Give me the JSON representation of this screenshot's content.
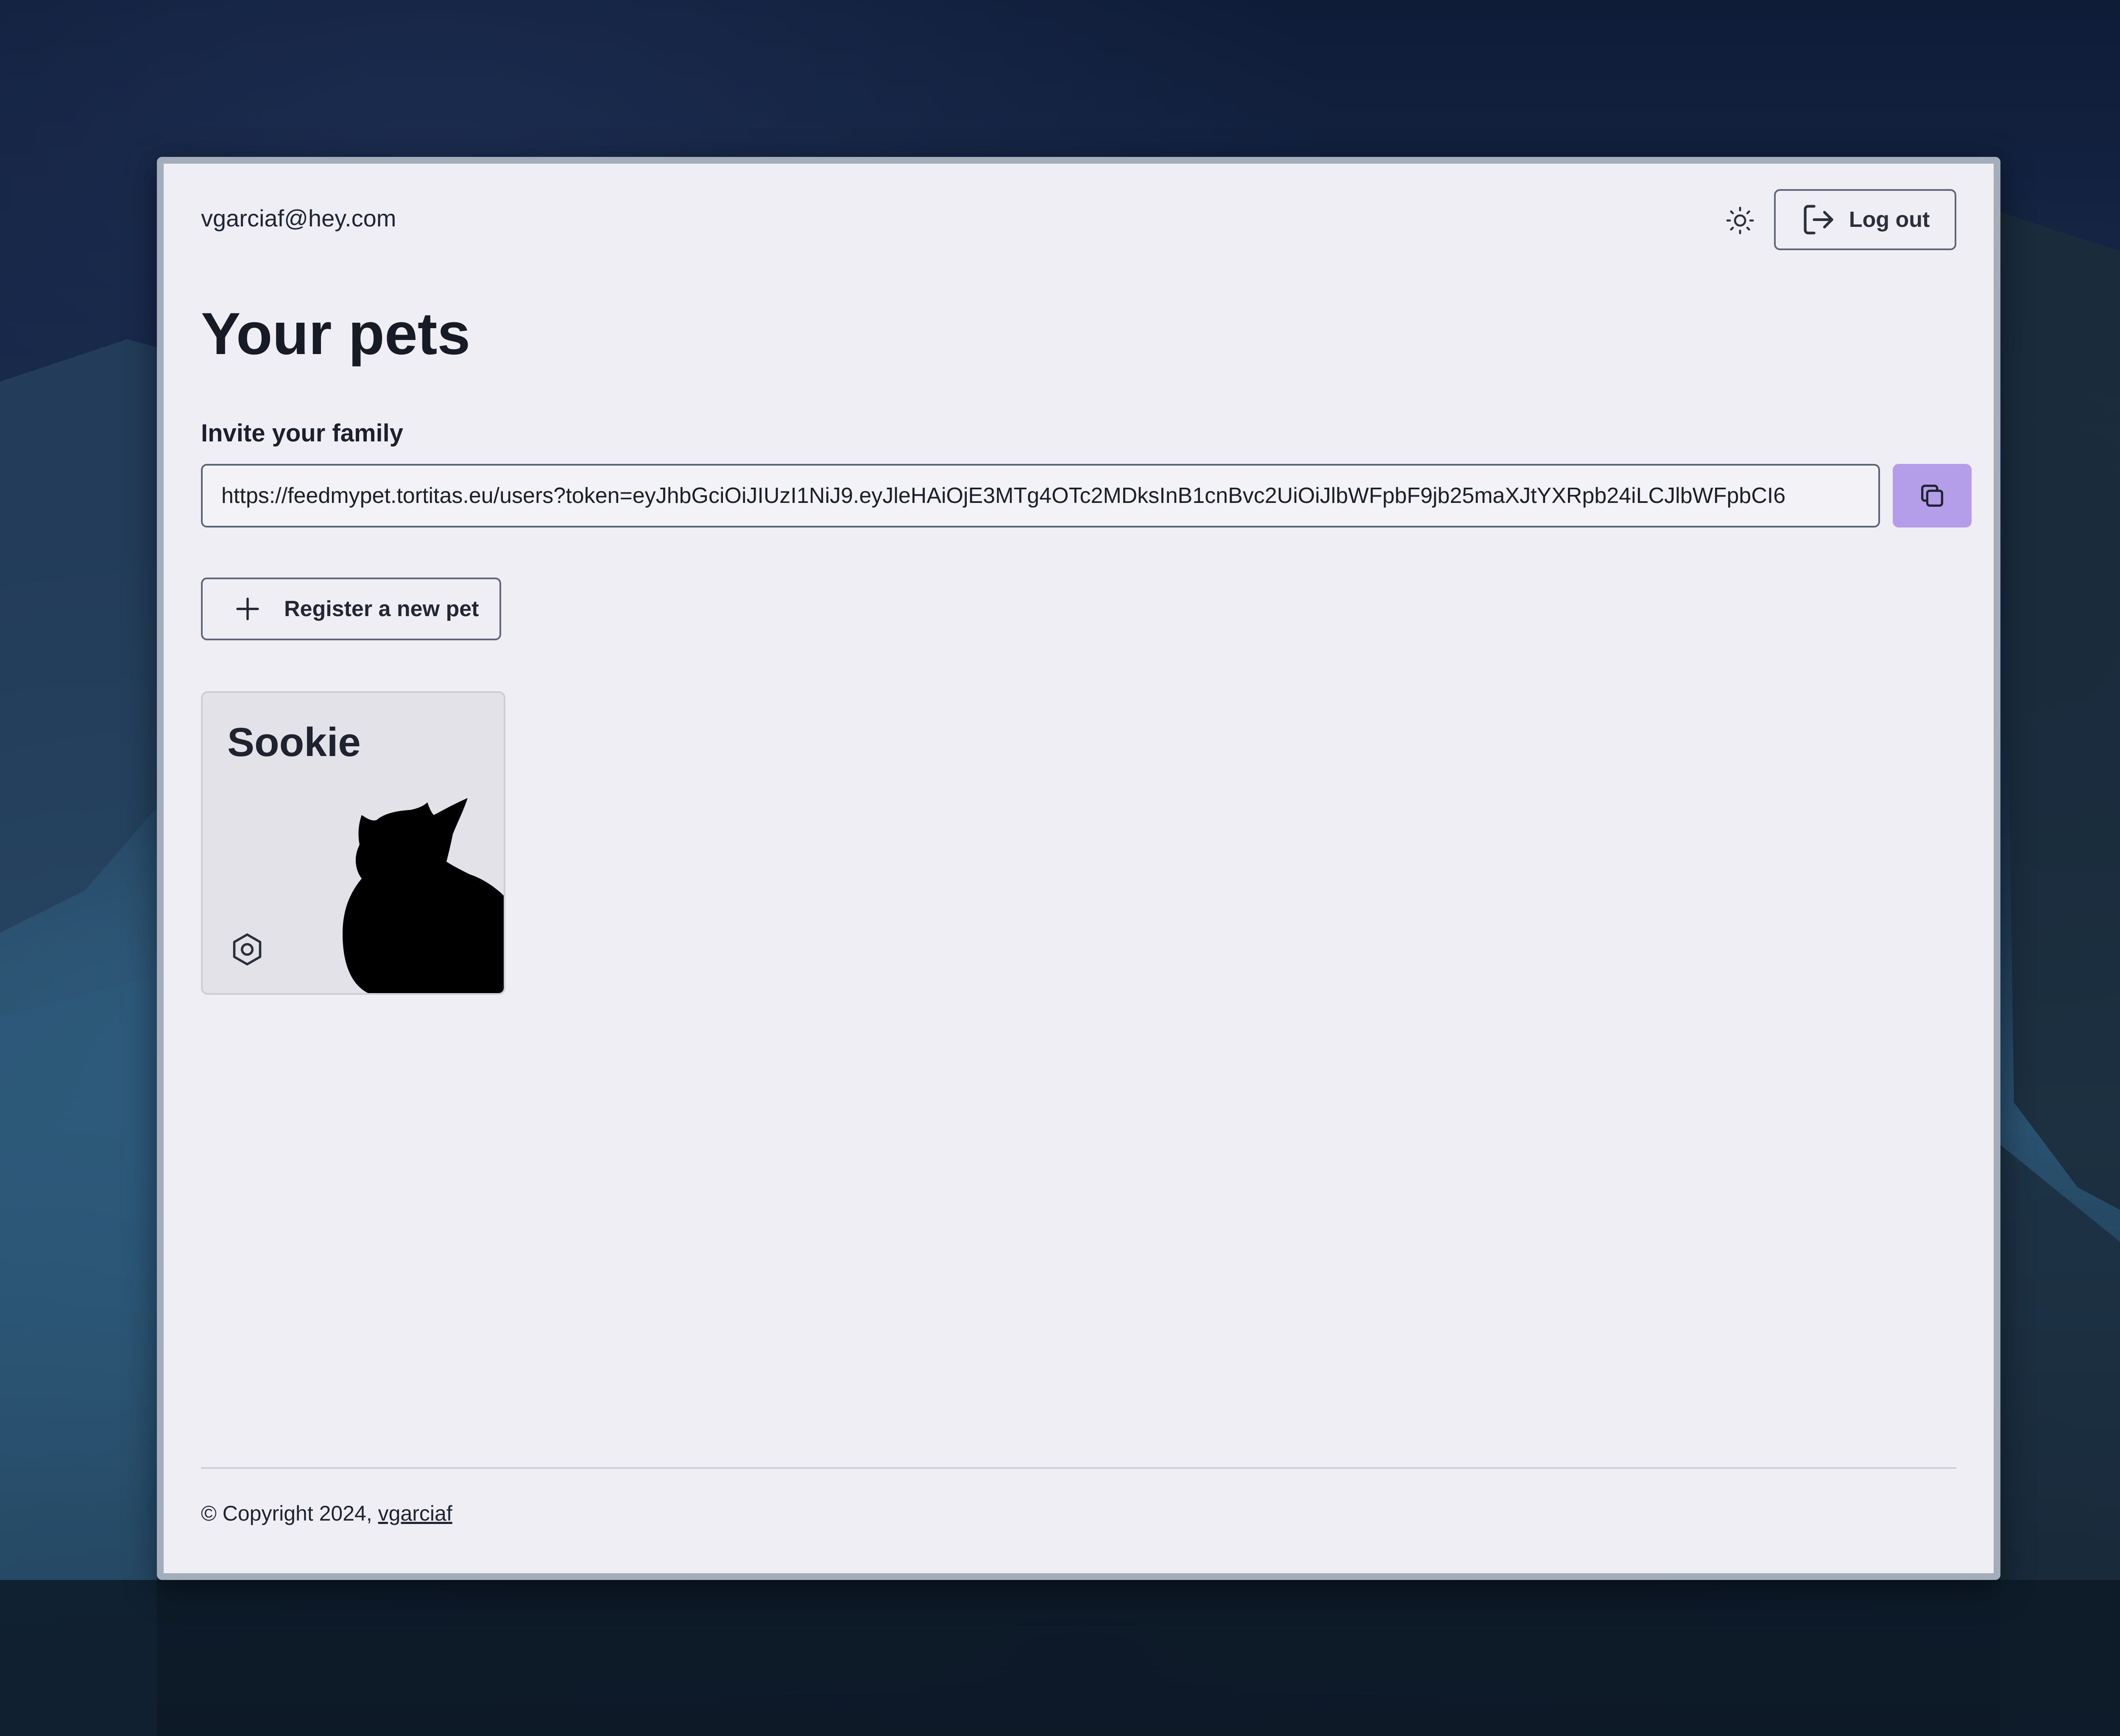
{
  "header": {
    "user_email": "vgarciaf@hey.com",
    "theme_toggle_icon": "sun-icon",
    "logout_label": "Log out",
    "logout_icon": "logout-icon"
  },
  "main": {
    "title": "Your pets",
    "invite": {
      "label": "Invite your family",
      "url": "https://feedmypet.tortitas.eu/users?token=eyJhbGciOiJIUzI1NiJ9.eyJleHAiOjE3MTg4OTc2MDksInB1cnBvc2UiOiJlbWFpbF9jb25maXJtYXRpb24iLCJlbWFpbCI6",
      "copy_icon": "copy-icon",
      "copy_color": "#b49de9"
    },
    "register_label": "Register a new pet",
    "register_icon": "plus-icon",
    "pets": [
      {
        "name": "Sookie",
        "settings_icon": "gear-icon",
        "image": "cat-silhouette"
      }
    ]
  },
  "footer": {
    "copyright_prefix": "© Copyright 2024, ",
    "author_link": "vgarciaf"
  }
}
